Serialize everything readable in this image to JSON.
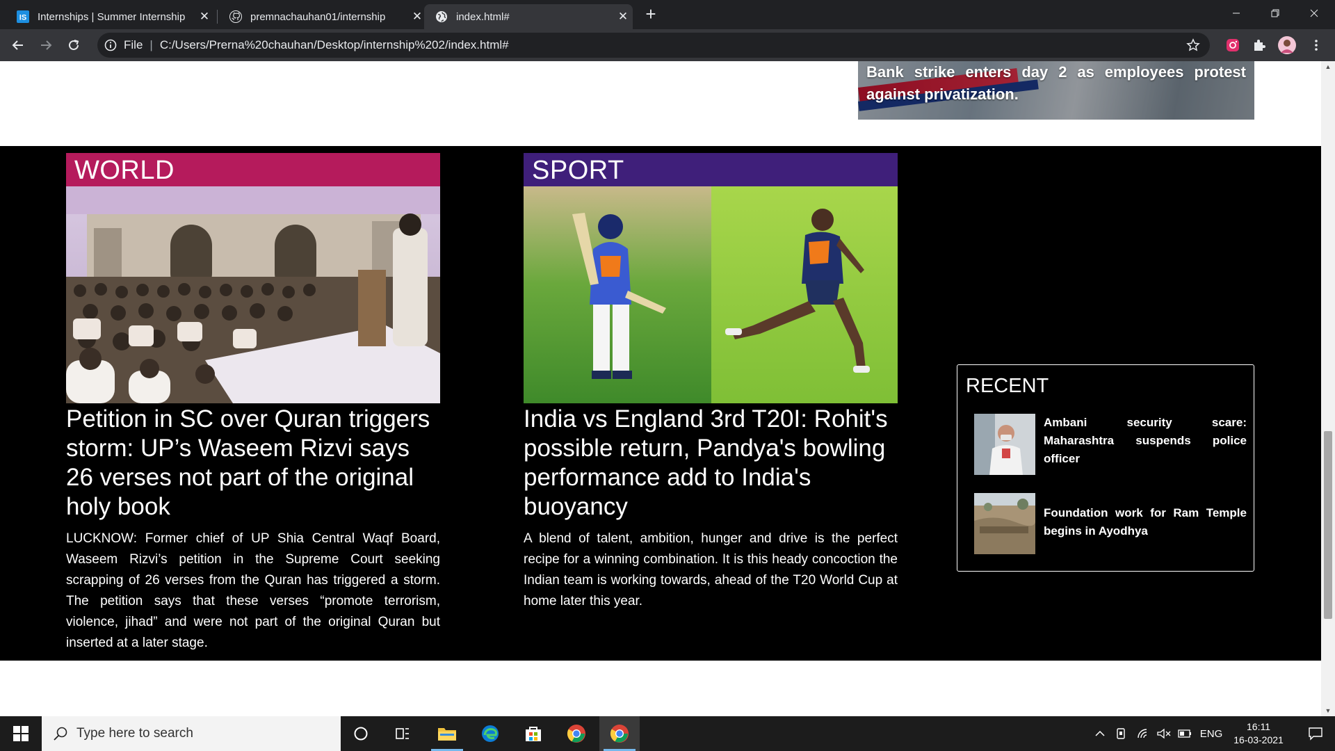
{
  "browser": {
    "tabs": [
      {
        "title": "Internships | Summer Internship",
        "favicon": "internshala-icon"
      },
      {
        "title": "premnachauhan01/internship",
        "favicon": "github-icon"
      },
      {
        "title": "index.html#",
        "favicon": "globe-icon"
      }
    ],
    "active_tab": 2,
    "address": {
      "scheme_label": "File",
      "url": "C:/Users/Prerna%20chauhan/Desktop/internship%202/index.html#"
    }
  },
  "page": {
    "banner_caption": "Bank strike enters day 2 as employees protest against privatization.",
    "world": {
      "category": "WORLD",
      "category_color": "#b51b5c",
      "headline": "Petition in SC over Quran triggers storm: UP’s Waseem Rizvi says 26 verses not part of the original holy book",
      "body": "LUCKNOW: Former chief of UP Shia Central Waqf Board, Waseem Rizvi’s petition in the Supreme Court seeking scrapping of 26 verses from the Quran has triggered a storm. The petition says that these verses “promote terrorism, violence, jihad” and were not part of the original Quran but inserted at a later stage."
    },
    "sport": {
      "category": "SPORT",
      "category_color": "#3f1f7a",
      "headline": "India vs England 3rd T20I: Rohit's possible return, Pandya's bowling performance add to India's buoyancy",
      "body": "A blend of talent, ambition, hunger and drive is the perfect recipe for a winning combination. It is this heady concoction the Indian team is working towards, ahead of the T20 World Cup at home later this year."
    },
    "recent": {
      "title": "RECENT",
      "items": [
        {
          "text": "Ambani security scare: Maharashtra suspends police officer"
        },
        {
          "text": "Foundation work for Ram Temple begins in Ayodhya"
        }
      ]
    }
  },
  "taskbar": {
    "search_placeholder": "Type here to search",
    "language": "ENG",
    "time": "16:11",
    "date": "16-03-2021"
  }
}
